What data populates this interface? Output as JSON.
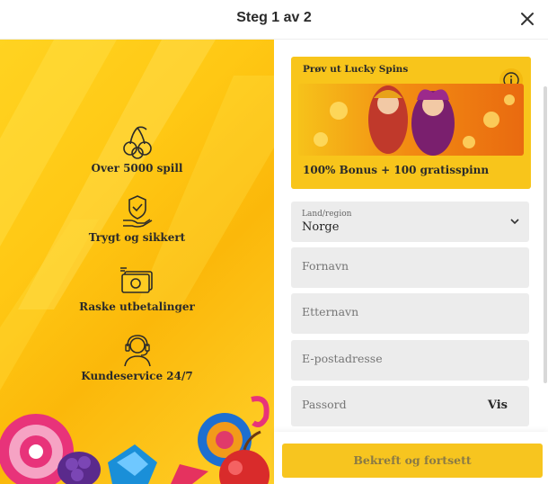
{
  "header": {
    "title": "Steg 1 av 2",
    "close_icon": "close-icon"
  },
  "features": [
    {
      "icon": "cherries-icon",
      "label": "Over 5000 spill"
    },
    {
      "icon": "shield-hand-icon",
      "label": "Trygt og sikkert"
    },
    {
      "icon": "money-icon",
      "label": "Raske utbetalinger"
    },
    {
      "icon": "headset-icon",
      "label": "Kundeservice 24/7"
    }
  ],
  "promo": {
    "title": "Prøv ut Lucky Spins",
    "bonus": "100% Bonus + 100 gratisspinn",
    "info_icon": "info-icon"
  },
  "form": {
    "country": {
      "label": "Land/region",
      "value": "Norge"
    },
    "first_name": {
      "placeholder": "Fornavn"
    },
    "last_name": {
      "placeholder": "Etternavn"
    },
    "email": {
      "placeholder": "E-postadresse"
    },
    "password": {
      "placeholder": "Passord",
      "show_label": "Vis"
    }
  },
  "submit": {
    "label": "Bekreft og fortsett"
  },
  "colors": {
    "accent": "#f7c51f",
    "left_bg": "#ffc814",
    "field_bg": "#ececec"
  }
}
